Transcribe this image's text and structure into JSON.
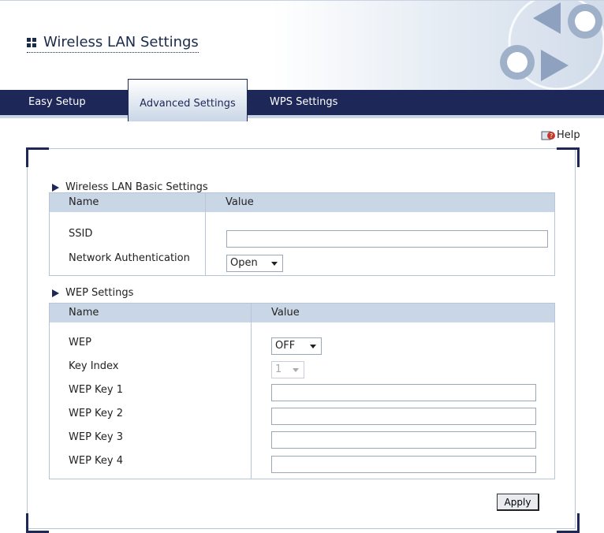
{
  "header": {
    "title": "Wireless LAN Settings"
  },
  "tabs": [
    {
      "label": "Easy Setup"
    },
    {
      "label": "Advanced Settings",
      "active": true
    },
    {
      "label": "WPS Settings"
    }
  ],
  "help": {
    "label": "Help"
  },
  "basic": {
    "section_title": "Wireless LAN Basic Settings",
    "col_name": "Name",
    "col_value": "Value",
    "ssid_label": "SSID",
    "ssid_value": "",
    "auth_label": "Network Authentication",
    "auth_value": "Open"
  },
  "wep": {
    "section_title": "WEP Settings",
    "col_name": "Name",
    "col_value": "Value",
    "wep_label": "WEP",
    "wep_value": "OFF",
    "key_index_label": "Key Index",
    "key_index_value": "1",
    "key1_label": "WEP Key 1",
    "key2_label": "WEP Key 2",
    "key3_label": "WEP Key 3",
    "key4_label": "WEP Key 4"
  },
  "actions": {
    "apply_label": "Apply"
  },
  "colors": {
    "nav": "#1d2858",
    "panel_head": "#c9d6e6",
    "border": "#b7c5d9"
  }
}
